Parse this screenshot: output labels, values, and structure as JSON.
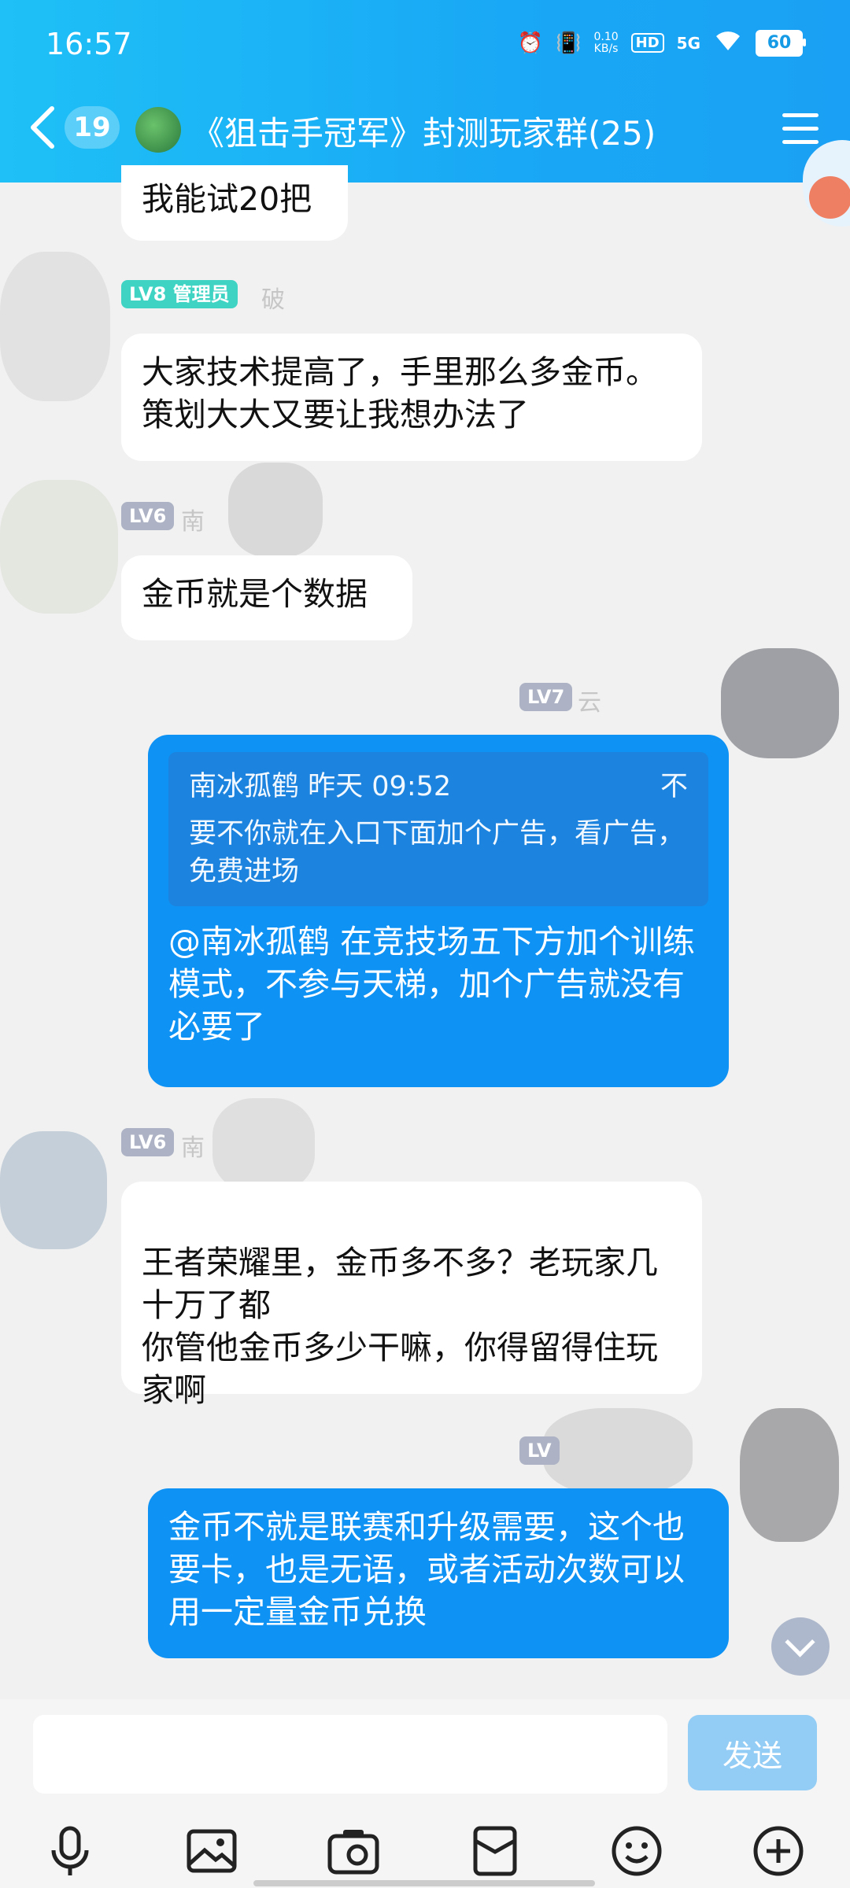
{
  "status_bar": {
    "time": "16:57",
    "speed_value": "0.10",
    "speed_unit": "KB/s",
    "hd": "HD",
    "network": "5G",
    "battery": "60"
  },
  "header": {
    "unread_count": "19",
    "title": "《狙击手冠军》封测玩家群(25)"
  },
  "messages": [
    {
      "text": "我能试20把"
    },
    {
      "level": "LV8",
      "role": "管理员",
      "name": "破",
      "text": "大家技术提高了，手里那么多金币。策划大大又要让我想办法了"
    },
    {
      "level": "LV6",
      "name": "南",
      "text": "金币就是个数据"
    },
    {
      "level": "LV7",
      "name": "云",
      "quote": {
        "author": "南冰孤鹤",
        "time": "昨天 09:52",
        "trailing": "不",
        "text": "要不你就在入口下面加个广告，看广告，免费进场"
      },
      "text": "@南冰孤鹤 在竞技场五下方加个训练模式，不参与天梯，加个广告就没有必要了"
    },
    {
      "level": "LV6",
      "name": "南",
      "text": "王者荣耀里，金币多不多？老玩家几十万了都\n你管他金币多少干嘛，你得留得住玩家啊"
    },
    {
      "level": "LV",
      "text": "金币不就是联赛和升级需要，这个也要卡，也是无语，或者活动次数可以用一定量金币兑换"
    }
  ],
  "input": {
    "placeholder": "",
    "send_label": "发送"
  },
  "toolbar": [
    "mic-icon",
    "image-icon",
    "camera-icon",
    "red-packet-icon",
    "emoji-icon",
    "plus-icon"
  ]
}
